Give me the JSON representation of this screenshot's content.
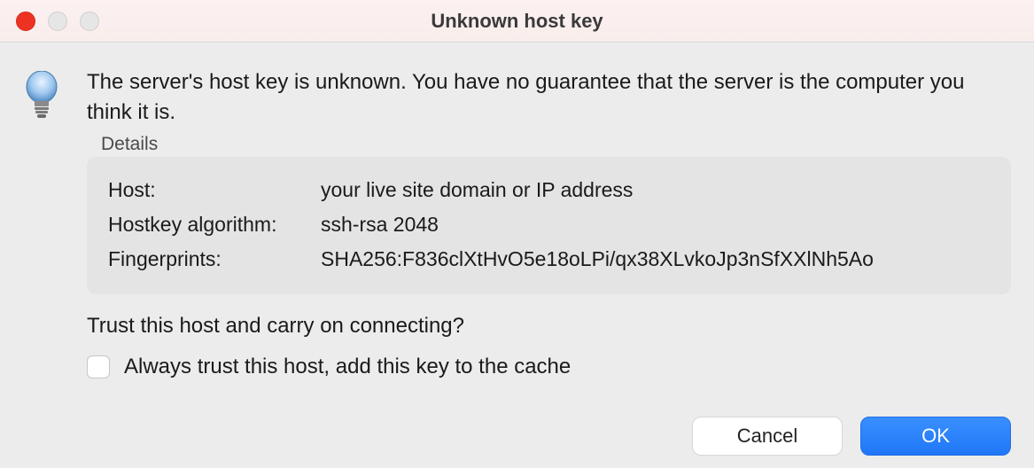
{
  "titlebar": {
    "title": "Unknown host key"
  },
  "dialog": {
    "warning": "The server's host key is unknown. You have no guarantee that the server is the computer you think it is.",
    "details_label": "Details",
    "details": {
      "host_label": "Host:",
      "host_value": "your live site domain or IP address",
      "algorithm_label": "Hostkey algorithm:",
      "algorithm_value": "ssh-rsa 2048",
      "fingerprints_label": "Fingerprints:",
      "fingerprints_value": "SHA256:F836clXtHvO5e18oLPi/qx38XLvkoJp3nSfXXlNh5Ao"
    },
    "trust_question": "Trust this host and carry on connecting?",
    "checkbox_label": "Always trust this host, add this key to the cache"
  },
  "buttons": {
    "cancel": "Cancel",
    "ok": "OK"
  }
}
